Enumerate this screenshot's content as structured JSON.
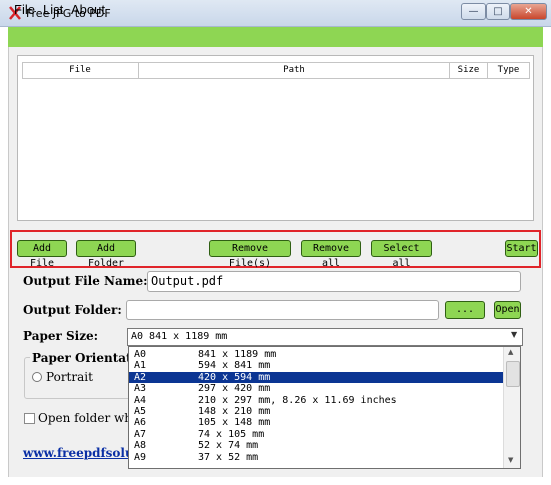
{
  "window": {
    "title": "Free JPG to PDF"
  },
  "menu": [
    "File",
    "List",
    "About"
  ],
  "table": {
    "columns": [
      "File",
      "Path",
      "Size",
      "Type"
    ]
  },
  "toolbar": {
    "add_file": "Add File",
    "add_folder": "Add Folder",
    "remove_files": "Remove File(s)",
    "remove_all": "Remove all",
    "select_all": "Select all",
    "start": "Start"
  },
  "output": {
    "file_name_label": "Output File Name:",
    "file_name_value": "Output.pdf",
    "folder_label": "Output Folder:",
    "folder_value": "",
    "browse_label": "...",
    "open_label": "Open"
  },
  "paper": {
    "size_label": "Paper Size:",
    "size_value": "A0 841 x 1189 mm",
    "orientation_label": "Paper Orientat",
    "portrait_label": "Portrait",
    "options": [
      {
        "name": "A0",
        "size": "841 x 1189 mm"
      },
      {
        "name": "A1",
        "size": "594 x 841 mm"
      },
      {
        "name": "A2",
        "size": "420 x 594 mm"
      },
      {
        "name": "A3",
        "size": "297 x 420 mm"
      },
      {
        "name": "A4",
        "size": "210 x 297 mm, 8.26 x 11.69 inches"
      },
      {
        "name": "A5",
        "size": "148 x 210 mm"
      },
      {
        "name": "A6",
        "size": "105 x 148 mm"
      },
      {
        "name": "A7",
        "size": "74 x 105 mm"
      },
      {
        "name": "A8",
        "size": "52 x 74 mm"
      },
      {
        "name": "A9",
        "size": "37 x 52 mm"
      }
    ],
    "selected_option": "A2"
  },
  "open_folder_label": "Open folder whe",
  "footer_link": "www.freepdfsolu",
  "colors": {
    "menu_green": "#8ed653",
    "highlight_red": "#e0242a",
    "selection_blue": "#0b3593"
  }
}
